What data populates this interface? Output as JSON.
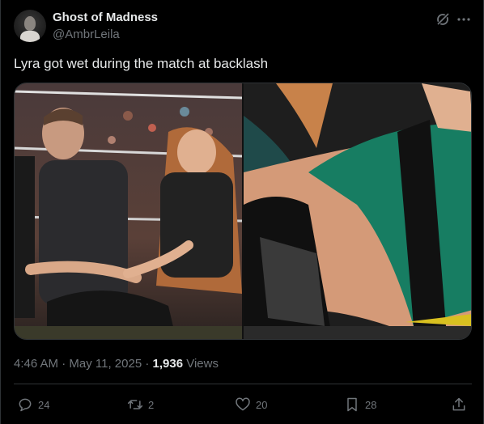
{
  "author": {
    "display_name": "Ghost of Madness",
    "handle": "@AmbrLeila"
  },
  "tweet": {
    "text": "Lyra got wet during the match at backlash"
  },
  "meta": {
    "time": "4:46 AM",
    "separator1": " · ",
    "date": "May 11, 2025",
    "separator2": " · ",
    "views_count": "1,936",
    "views_label": " Views"
  },
  "actions": {
    "replies": "24",
    "reposts": "2",
    "likes": "20",
    "bookmarks": "28"
  },
  "icons": {
    "grok": "grok-icon",
    "more": "more-icon",
    "reply": "reply-icon",
    "repost": "repost-icon",
    "like": "heart-icon",
    "bookmark": "bookmark-icon",
    "share": "share-icon"
  },
  "colors": {
    "background": "#000000",
    "text_primary": "#e7e9ea",
    "text_secondary": "#71767b",
    "border": "#2f3336"
  }
}
